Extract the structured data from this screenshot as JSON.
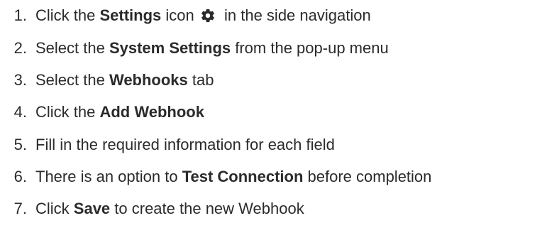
{
  "steps": [
    {
      "number": "1.",
      "before": "Click the ",
      "bold": "Settings",
      "middle": " icon",
      "icon": "gear-icon",
      "after": " in the side navigation"
    },
    {
      "number": "2.",
      "before": "Select the ",
      "bold": "System Settings",
      "after": " from the pop-up menu"
    },
    {
      "number": "3.",
      "before": "Select the ",
      "bold": "Webhooks",
      "after": " tab"
    },
    {
      "number": "4.",
      "before": "Click the ",
      "bold": "Add Webhook",
      "after": ""
    },
    {
      "number": "5.",
      "before": "Fill in the required information for each field",
      "bold": "",
      "after": ""
    },
    {
      "number": "6.",
      "before": "There is an option to ",
      "bold": "Test Connection",
      "after": " before completion"
    },
    {
      "number": "7.",
      "before": "Click ",
      "bold": "Save",
      "after": " to create the new Webhook"
    }
  ],
  "colors": {
    "text": "#2b2b2b",
    "icon": "#2b2b2b"
  }
}
